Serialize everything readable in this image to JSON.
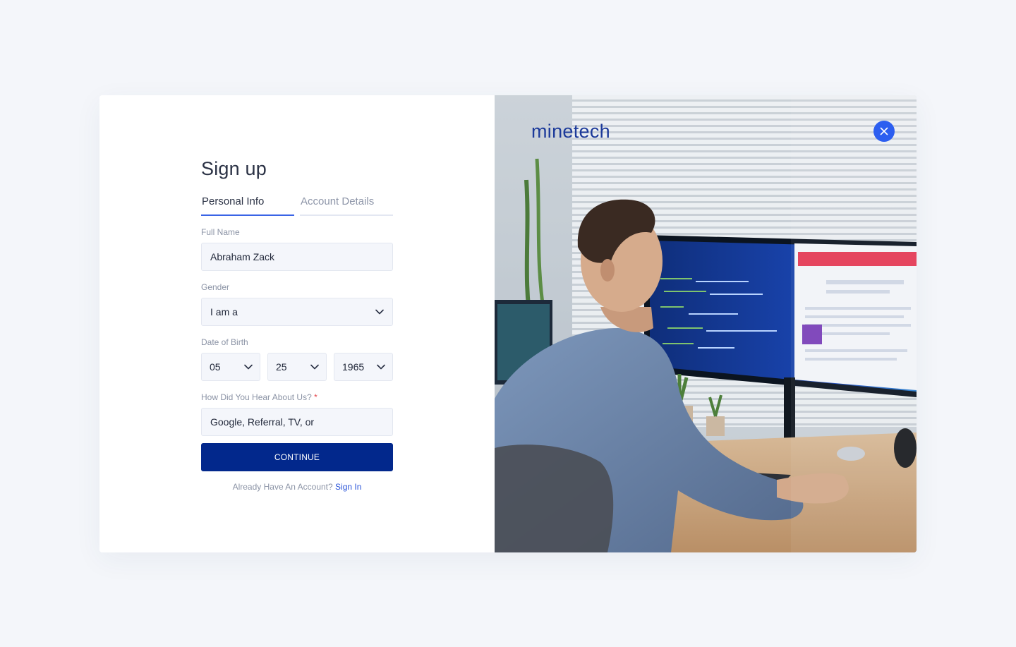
{
  "form": {
    "title": "Sign up",
    "tabs": [
      {
        "label": "Personal Info",
        "active": true
      },
      {
        "label": "Account Details",
        "active": false
      }
    ],
    "full_name": {
      "label": "Full Name",
      "value": "Abraham Zack"
    },
    "gender": {
      "label": "Gender",
      "value": "I am a"
    },
    "dob": {
      "label": "Date of Birth",
      "month": "05",
      "day": "25",
      "year": "1965"
    },
    "referral": {
      "label": "How Did You Hear About Us?",
      "required_mark": "*",
      "placeholder": "Google, Referral, TV, or"
    },
    "continue_label": "CONTINUE",
    "signin_prompt": "Already Have An Account?",
    "signin_link": "Sign In"
  },
  "side": {
    "brand": "minetech",
    "close_icon": "close-icon",
    "photo": "man-at-desk-with-curved-monitor"
  },
  "colors": {
    "accent": "#3a64e6",
    "primary_button": "#02288c",
    "link": "#2b55d9",
    "close_button": "#2c5ef0",
    "brand_text": "#1c3a9a",
    "page_bg": "#f4f6fa"
  }
}
